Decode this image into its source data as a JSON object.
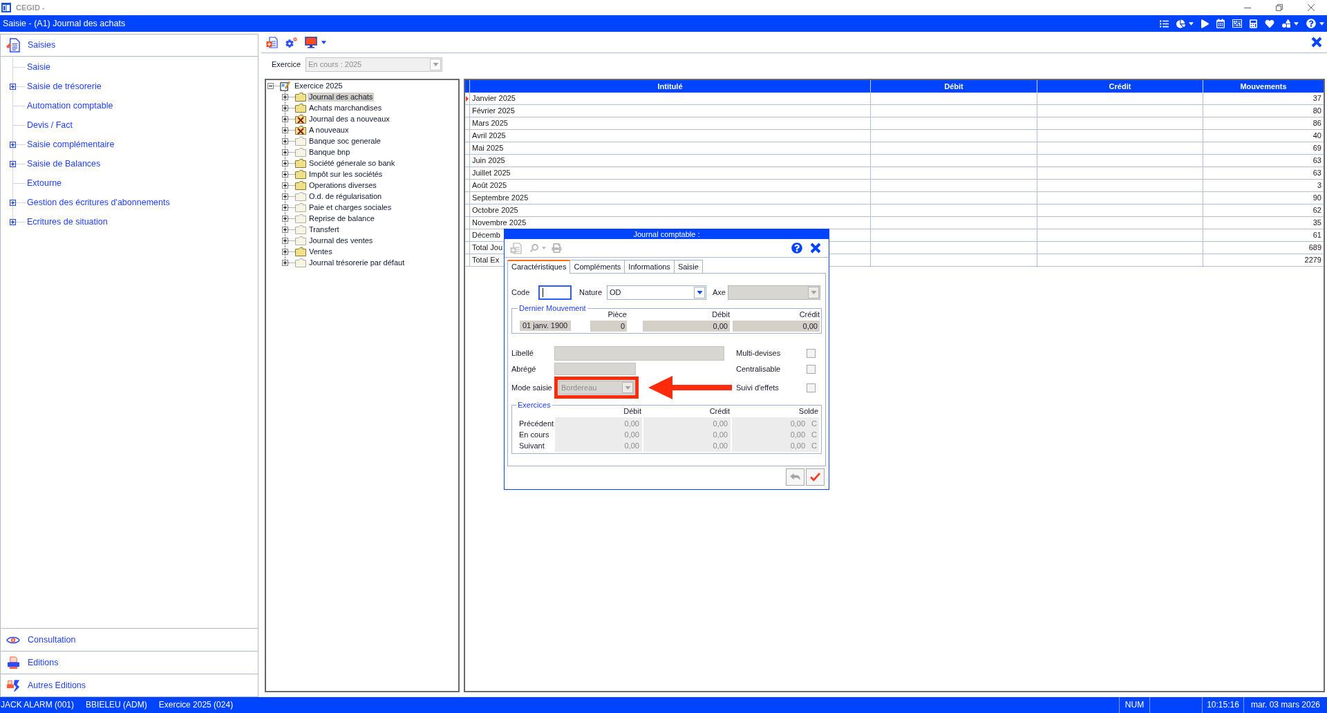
{
  "window": {
    "title": "CEGID -"
  },
  "app_bar": {
    "title": "Saisie - (A1) Journal des achats"
  },
  "sidebar": {
    "header": "Saisies",
    "items": [
      {
        "label": "Saisie",
        "kind": "leaf"
      },
      {
        "label": "Saisie de trésorerie",
        "kind": "group",
        "expanded": false
      },
      {
        "label": "Automation comptable",
        "kind": "leaf"
      },
      {
        "label": "Devis / Fact",
        "kind": "leaf"
      },
      {
        "label": "Saisie complémentaire",
        "kind": "group",
        "expanded": false
      },
      {
        "label": "Saisie de Balances",
        "kind": "group",
        "expanded": false
      },
      {
        "label": "Extourne",
        "kind": "leaf"
      },
      {
        "label": "Gestion des écritures d'abonnements",
        "kind": "group",
        "expanded": false
      },
      {
        "label": "Ecritures de situation",
        "kind": "group",
        "expanded": false
      }
    ],
    "sections": [
      {
        "label": "Consultation",
        "kind": "eye"
      },
      {
        "label": "Editions",
        "kind": "printer"
      },
      {
        "label": "Autres Editions",
        "kind": "report"
      }
    ]
  },
  "exercice": {
    "label": "Exercice",
    "value": "En cours : 2025",
    "disabled": true
  },
  "tree": {
    "label": "Exercice 2025",
    "expanded": true,
    "children": [
      {
        "label": "Journal des achats",
        "kind": "folder",
        "expanded": false,
        "selected": true
      },
      {
        "label": "Achats marchandises",
        "kind": "folder",
        "expanded": false,
        "selected": false
      },
      {
        "label": "Journal des a nouveaux",
        "kind": "crossed",
        "expanded": false,
        "selected": false
      },
      {
        "label": "A nouveaux",
        "kind": "crossed",
        "expanded": false,
        "selected": false
      },
      {
        "label": "Banque soc generale",
        "kind": "faded",
        "expanded": false,
        "selected": false
      },
      {
        "label": "Banque bnp",
        "kind": "faded",
        "expanded": false,
        "selected": false
      },
      {
        "label": "Société génerale so bank",
        "kind": "folder",
        "expanded": false,
        "selected": false
      },
      {
        "label": "Impôt sur les sociétés",
        "kind": "folder",
        "expanded": false,
        "selected": false
      },
      {
        "label": "Operations diverses",
        "kind": "folder",
        "expanded": false,
        "selected": false
      },
      {
        "label": "O.d. de régularisation",
        "kind": "faded",
        "expanded": false,
        "selected": false
      },
      {
        "label": "Paie et charges sociales",
        "kind": "faded",
        "expanded": false,
        "selected": false
      },
      {
        "label": "Reprise de balance",
        "kind": "faded",
        "expanded": false,
        "selected": false
      },
      {
        "label": "Transfert",
        "kind": "faded",
        "expanded": false,
        "selected": false
      },
      {
        "label": "Journal des ventes",
        "kind": "faded",
        "expanded": false,
        "selected": false
      },
      {
        "label": "Ventes",
        "kind": "folder",
        "expanded": false,
        "selected": false
      },
      {
        "label": "Journal trésorerie par défaut",
        "kind": "faded",
        "expanded": false,
        "selected": false
      }
    ]
  },
  "table": {
    "columns": [
      "Intitulé",
      "Débit",
      "Crédit",
      "Mouvements"
    ],
    "rows": [
      {
        "intitule": "Janvier 2025",
        "mouvements": "37",
        "selected": true
      },
      {
        "intitule": "Février 2025",
        "mouvements": "80",
        "selected": false
      },
      {
        "intitule": "Mars 2025",
        "mouvements": "86",
        "selected": false
      },
      {
        "intitule": "Avril 2025",
        "mouvements": "40",
        "selected": false
      },
      {
        "intitule": "Mai 2025",
        "mouvements": "69",
        "selected": false
      },
      {
        "intitule": "Juin 2025",
        "mouvements": "63",
        "selected": false
      },
      {
        "intitule": "Juillet 2025",
        "mouvements": "63",
        "selected": false
      },
      {
        "intitule": "Août 2025",
        "mouvements": "3",
        "selected": false
      },
      {
        "intitule": "Septembre 2025",
        "mouvements": "90",
        "selected": false
      },
      {
        "intitule": "Octobre 2025",
        "mouvements": "62",
        "selected": false
      },
      {
        "intitule": "Novembre 2025",
        "mouvements": "35",
        "selected": false
      },
      {
        "intitule": "Décemb",
        "mouvements": "61",
        "selected": false
      },
      {
        "intitule": "Total Jou",
        "mouvements": "689",
        "selected": false
      },
      {
        "intitule": "Total Ex",
        "mouvements": "2279",
        "selected": false
      }
    ]
  },
  "dialog": {
    "title": "Journal comptable :",
    "tabs": [
      {
        "label": "Caractéristiques",
        "selected": true
      },
      {
        "label": "Compléments",
        "selected": false
      },
      {
        "label": "Informations",
        "selected": false
      },
      {
        "label": "Saisie",
        "selected": false
      }
    ],
    "code": {
      "label": "Code",
      "focused": true
    },
    "nature": {
      "label": "Nature",
      "value": "OD",
      "disabled": false
    },
    "axe": {
      "label": "Axe",
      "disabled": true
    },
    "dernier_mouvement": {
      "title": "Dernier Mouvement",
      "columns": [
        "Pièce",
        "Débit",
        "Crédit"
      ],
      "date": "01 janv. 1900",
      "piece": "0",
      "debit": "0,00",
      "credit": "0,00"
    },
    "libelle": {
      "label": "Libellé",
      "disabled": true
    },
    "abrege": {
      "label": "Abrégé",
      "disabled": true
    },
    "mode_saisie": {
      "label": "Mode saisie",
      "value": "Bordereau",
      "disabled": true,
      "highlighted": true
    },
    "options": [
      {
        "label": "Multi-devises",
        "checked": false
      },
      {
        "label": "Centralisable",
        "checked": false
      },
      {
        "label": "Suivi d'effets",
        "checked": false
      }
    ],
    "exercices": {
      "title": "Exercices",
      "columns": [
        "Débit",
        "Crédit",
        "Solde"
      ],
      "rows": [
        {
          "label": "Précédent",
          "debit": "0,00",
          "credit": "0,00",
          "solde": "0,00",
          "sens": "C"
        },
        {
          "label": "En cours",
          "debit": "0,00",
          "credit": "0,00",
          "solde": "0,00",
          "sens": "C"
        },
        {
          "label": "Suivant",
          "debit": "0,00",
          "credit": "0,00",
          "solde": "0,00",
          "sens": "C"
        }
      ]
    },
    "buttons": [
      {
        "kind": "back",
        "disabled": true
      },
      {
        "kind": "ok",
        "disabled": false
      }
    ]
  },
  "status_bar": {
    "left": [
      "JACK ALARM (001)",
      "BBIELEU (ADM)",
      "Exercice 2025 (024)"
    ],
    "indicators": [
      "NUM"
    ],
    "time": "10:15:16",
    "date": "mar. 03 mars 2026"
  }
}
